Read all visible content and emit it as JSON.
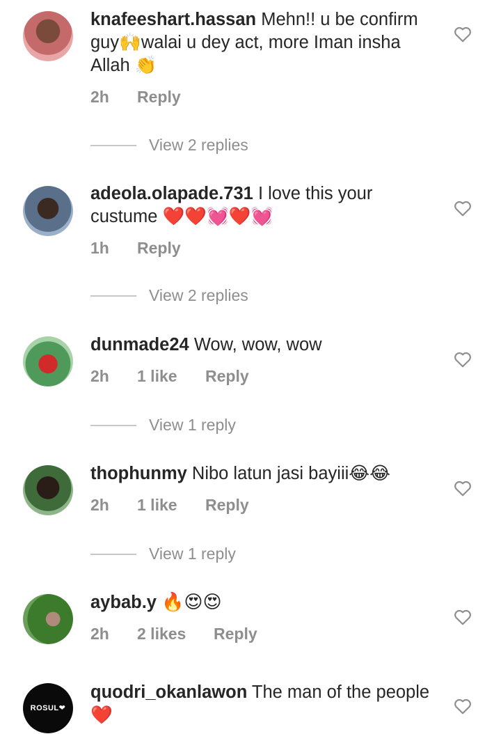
{
  "comments": [
    {
      "username": "knafeeshart.hassan",
      "text": "Mehn!! u be confirm guy🙌walai u dey act, more Iman  insha Allah 👏",
      "time": "2h",
      "likes": "",
      "reply": "Reply",
      "view_replies": "View 2 replies"
    },
    {
      "username": "adeola.olapade.731",
      "text": "I love this your custume ❤️❤️💓❤️💓",
      "time": "1h",
      "likes": "",
      "reply": "Reply",
      "view_replies": "View 2 replies"
    },
    {
      "username": "dunmade24",
      "text": "Wow, wow, wow",
      "time": "2h",
      "likes": "1 like",
      "reply": "Reply",
      "view_replies": "View 1 reply"
    },
    {
      "username": "thophunmy",
      "text": "Nibo latun jasi bayiii😂😂",
      "time": "2h",
      "likes": "1 like",
      "reply": "Reply",
      "view_replies": "View 1 reply"
    },
    {
      "username": "aybab.y",
      "text": "🔥😍😍",
      "time": "2h",
      "likes": "2 likes",
      "reply": "Reply",
      "view_replies": ""
    },
    {
      "username": "quodri_okanlawon",
      "text": "The man of the people ❤️",
      "avatar_text": "ROSUL❤",
      "time": "",
      "likes": "",
      "reply": "",
      "view_replies": ""
    }
  ],
  "colors": {
    "text": "#262626",
    "muted": "#8e8e8e",
    "divider": "#c7c7c7"
  },
  "icons": {
    "like": "heart-outline-icon"
  }
}
